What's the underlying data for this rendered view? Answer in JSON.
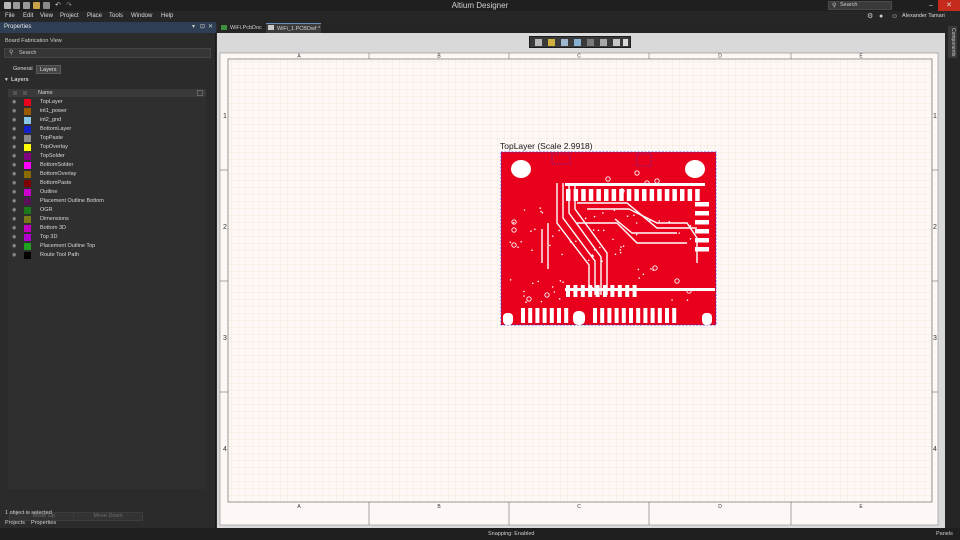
{
  "app": {
    "title": "Altium Designer",
    "search_placeholder": "Search",
    "user": "Alexander Tamari"
  },
  "menu": [
    "File",
    "Edit",
    "View",
    "Project",
    "Place",
    "Tools",
    "Window",
    "Help"
  ],
  "properties_panel": {
    "title": "Properties",
    "subtitle": "Board Fabrication View",
    "search_placeholder": "Search",
    "tabs": [
      "General",
      "Layers"
    ],
    "section": "Layers",
    "column_header": "Name",
    "layers": [
      {
        "name": "TopLayer",
        "color": "#e8001c"
      },
      {
        "name": "int1_power",
        "color": "#9a5a00"
      },
      {
        "name": "int2_gnd",
        "color": "#89c7e8"
      },
      {
        "name": "BottomLayer",
        "color": "#1420c8"
      },
      {
        "name": "TopPaste",
        "color": "#8a8a8a"
      },
      {
        "name": "TopOverlay",
        "color": "#ffff00"
      },
      {
        "name": "TopSolder",
        "color": "#800080"
      },
      {
        "name": "BottomSolder",
        "color": "#ff00ff"
      },
      {
        "name": "BottomOverlay",
        "color": "#8b6b00"
      },
      {
        "name": "BottomPaste",
        "color": "#800000"
      },
      {
        "name": "Outline",
        "color": "#cc00cc"
      },
      {
        "name": "Placement Outline Bottom",
        "color": "#5a0f5a"
      },
      {
        "name": "OGR",
        "color": "#1a7a1a"
      },
      {
        "name": "Dimensions",
        "color": "#7a7a1a"
      },
      {
        "name": "Bottom 3D",
        "color": "#c000c0"
      },
      {
        "name": "Top 3D",
        "color": "#b000d0"
      },
      {
        "name": "Placement Outline Top",
        "color": "#20a020"
      },
      {
        "name": "Route Tool Path",
        "color": "#000000"
      }
    ],
    "move_up": "Move Up",
    "move_down": "Move Down",
    "selection_status": "1 object is selected"
  },
  "bottom_tabs": [
    "Projects",
    "Properties"
  ],
  "doc_tabs": [
    "WiFi.PcbDoc",
    "WiFi_1.PCBDwf *"
  ],
  "sheet": {
    "columns": [
      "A",
      "B",
      "C",
      "D",
      "E"
    ],
    "rows": [
      "1",
      "2",
      "3",
      "4"
    ],
    "view_label": "TopLayer (Scale 2.9918)"
  },
  "right_panel_tab": "Components",
  "status": {
    "snapping": "Snapping: Enabled",
    "panels": "Panels"
  }
}
